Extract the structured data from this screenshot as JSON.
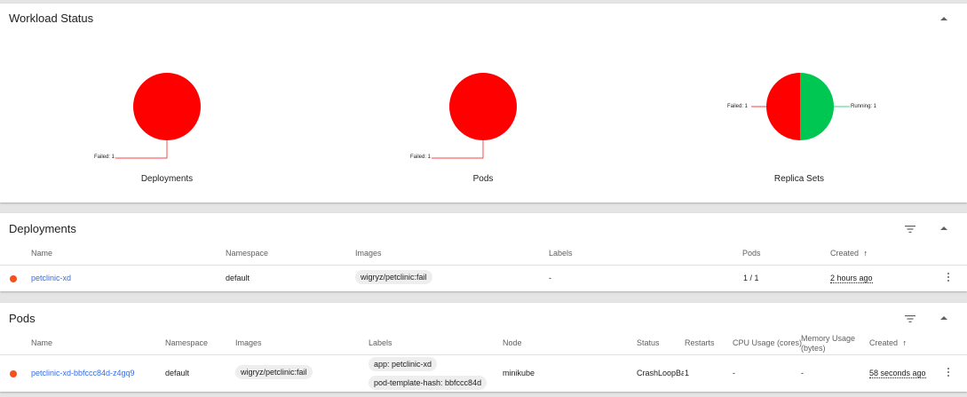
{
  "workload": {
    "title": "Workload Status",
    "charts": [
      {
        "label": "Deployments",
        "legend_left": "Failed: 1"
      },
      {
        "label": "Pods",
        "legend_left": "Failed: 1"
      },
      {
        "label": "Replica Sets",
        "legend_left": "Failed: 1",
        "legend_right": "Running: 1"
      }
    ]
  },
  "chart_data": [
    {
      "type": "pie",
      "title": "Deployments",
      "slices": [
        {
          "label": "Failed",
          "value": 1,
          "color": "#ff0000"
        }
      ]
    },
    {
      "type": "pie",
      "title": "Pods",
      "slices": [
        {
          "label": "Failed",
          "value": 1,
          "color": "#ff0000"
        }
      ]
    },
    {
      "type": "pie",
      "title": "Replica Sets",
      "slices": [
        {
          "label": "Failed",
          "value": 1,
          "color": "#ff0000"
        },
        {
          "label": "Running",
          "value": 1,
          "color": "#00c752"
        }
      ]
    }
  ],
  "deployments": {
    "title": "Deployments",
    "columns": {
      "name": "Name",
      "namespace": "Namespace",
      "images": "Images",
      "labels": "Labels",
      "pods": "Pods",
      "created": "Created"
    },
    "sort_arrow": "↑",
    "rows": [
      {
        "name": "petclinic-xd",
        "namespace": "default",
        "image": "wigryz/petclinic:fail",
        "labels": "-",
        "pods": "1 / 1",
        "created": "2 hours ago",
        "status_color": "#f4511e"
      }
    ]
  },
  "pods": {
    "title": "Pods",
    "columns": {
      "name": "Name",
      "namespace": "Namespace",
      "images": "Images",
      "labels": "Labels",
      "node": "Node",
      "status": "Status",
      "restarts": "Restarts",
      "cpu": "CPU Usage (cores)",
      "memory_line1": "Memory Usage",
      "memory_line2": "(bytes)",
      "created": "Created"
    },
    "sort_arrow": "↑",
    "rows": [
      {
        "name": "petclinic-xd-bbfccc84d-z4gq9",
        "namespace": "default",
        "image": "wigryz/petclinic:fail",
        "label1": "app: petclinic-xd",
        "label2": "pod-template-hash: bbfccc84d",
        "node": "minikube",
        "status": "CrashLoopBackOff",
        "restarts": "1",
        "cpu": "-",
        "memory": "-",
        "created": "58 seconds ago",
        "status_color": "#f4511e"
      }
    ]
  },
  "icons": {
    "collapse": "chevron-up-icon",
    "filter": "filter-icon",
    "menu": "more-vert-icon"
  }
}
